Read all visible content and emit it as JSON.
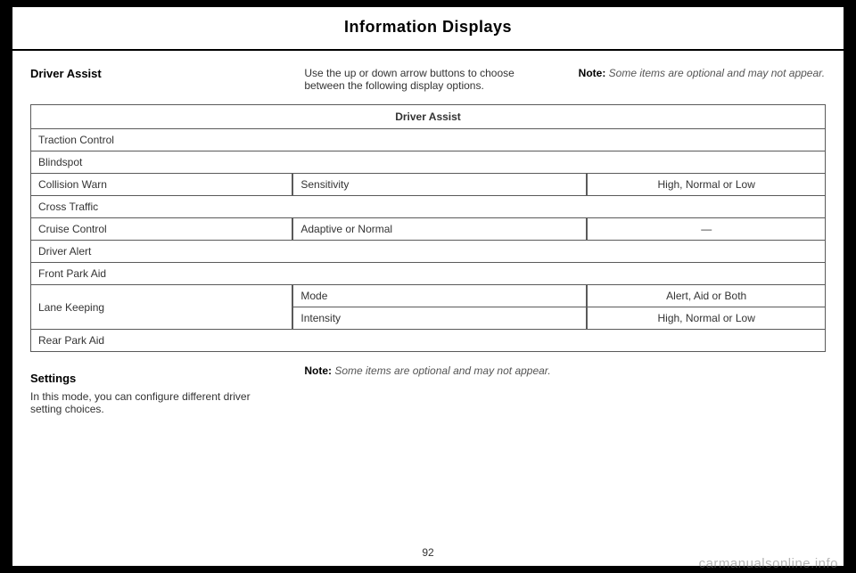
{
  "page_title": "Information Displays",
  "top": {
    "section_head": "Driver Assist",
    "instruction": "Use the up or down arrow buttons to choose between the following display options.",
    "note_label": "Note:",
    "note_text": " Some items are optional and may not appear."
  },
  "table": {
    "header": "Driver Assist",
    "rows": {
      "traction": "Traction Control",
      "blindspot": "Blindspot",
      "collision_warn": "Collision Warn",
      "collision_warn_param": "Sensitivity",
      "collision_warn_val": "High, Normal or Low",
      "cross_traffic": "Cross Traffic",
      "cruise_control": "Cruise Control",
      "cruise_control_param": "Adaptive or Normal",
      "cruise_control_val": "—",
      "driver_alert": "Driver Alert",
      "front_park_aid": "Front Park Aid",
      "lane_keeping": "Lane Keeping",
      "lane_keeping_mode": "Mode",
      "lane_keeping_mode_val": "Alert, Aid or Both",
      "lane_keeping_intensity": "Intensity",
      "lane_keeping_intensity_val": "High, Normal or Low",
      "rear_park_aid": "Rear Park Aid"
    }
  },
  "bottom": {
    "settings_head": "Settings",
    "settings_text": "In this mode, you can configure different driver setting choices.",
    "note_label": "Note:",
    "note_text": " Some items are optional and may not appear."
  },
  "page_number": "92",
  "watermark": "carmanualsonline.info"
}
